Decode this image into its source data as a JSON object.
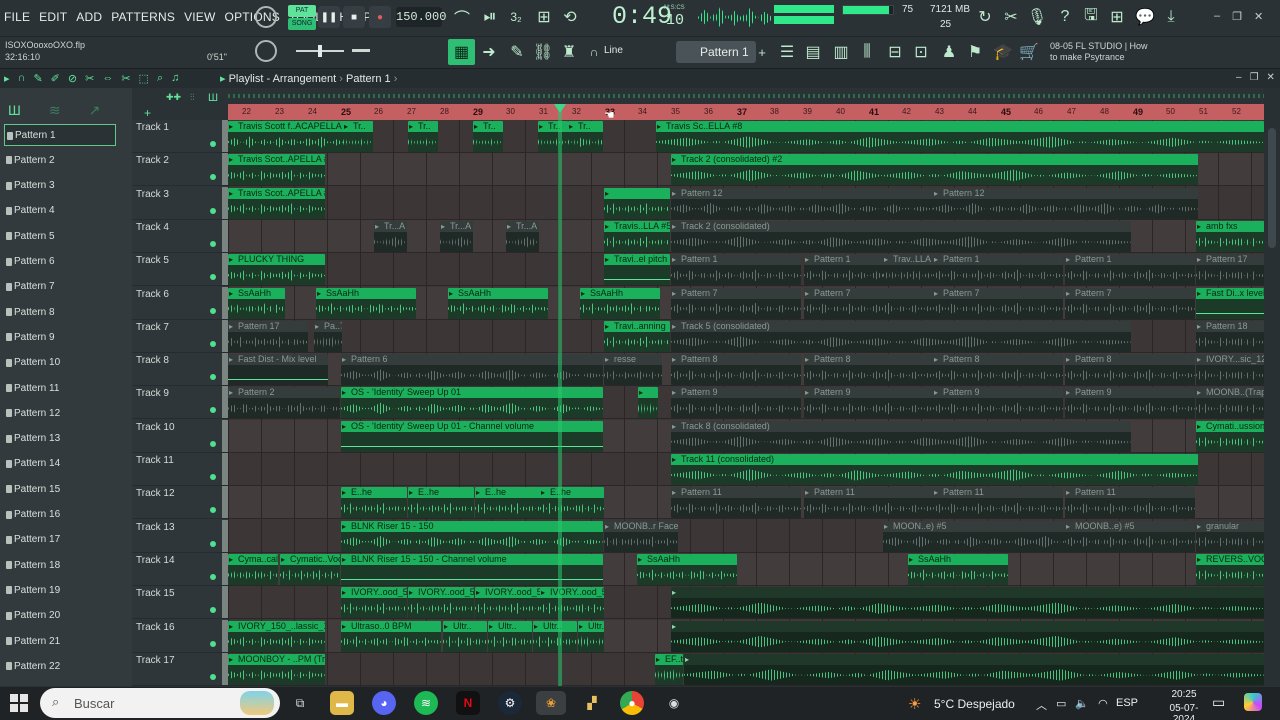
{
  "menu": [
    "FILE",
    "EDIT",
    "ADD",
    "PATTERNS",
    "VIEW",
    "OPTIONS",
    "TOOLS",
    "HELP"
  ],
  "transport": {
    "pat_label": "PAT",
    "song_label": "SONG",
    "tempo": "150.000",
    "time": "0:49",
    "time_sub": "10",
    "time_unit": "M:S:CS"
  },
  "stats": {
    "cpu": "75",
    "memory": "7121 MB",
    "voices": "25"
  },
  "project": {
    "file": "ISOXOooxoOXO.flp",
    "position": "32:16:10",
    "length": "0'51\""
  },
  "toolbar": {
    "snap": "Line",
    "pattern": "Pattern 1"
  },
  "news": {
    "date": "08-05",
    "text1": "FL STUDIO | How",
    "text2": "to make Psytrance"
  },
  "playlist": {
    "title": "Playlist - Arrangement",
    "crumb": "Pattern 1"
  },
  "patterns": [
    "Pattern 1",
    "Pattern 2",
    "Pattern 3",
    "Pattern 4",
    "Pattern 5",
    "Pattern 6",
    "Pattern 7",
    "Pattern 8",
    "Pattern 9",
    "Pattern 10",
    "Pattern 11",
    "Pattern 12",
    "Pattern 13",
    "Pattern 14",
    "Pattern 15",
    "Pattern 16",
    "Pattern 17",
    "Pattern 18",
    "Pattern 19",
    "Pattern 20",
    "Pattern 21",
    "Pattern 22"
  ],
  "tracks": [
    "Track 1",
    "Track 2",
    "Track 3",
    "Track 4",
    "Track 5",
    "Track 6",
    "Track 7",
    "Track 8",
    "Track 9",
    "Track 10",
    "Track 11",
    "Track 12",
    "Track 13",
    "Track 14",
    "Track 15",
    "Track 16",
    "Track 17"
  ],
  "ruler": [
    "22",
    "23",
    "24",
    "25",
    "26",
    "27",
    "28",
    "29",
    "30",
    "31",
    "32",
    "33",
    "34",
    "35",
    "36",
    "37",
    "38",
    "39",
    "40",
    "41",
    "42",
    "43",
    "44",
    "45",
    "46",
    "47",
    "48",
    "49",
    "50",
    "51",
    "52"
  ],
  "clips": [
    {
      "t": 0,
      "c": "g",
      "l": "Travis Scott f..ACAPELLA #8"
    },
    {
      "t": 0,
      "c": "g",
      "l": "Tr.."
    },
    {
      "t": 0,
      "c": "g",
      "l": "Tr.."
    },
    {
      "t": 0,
      "c": "g",
      "l": "Tr.."
    },
    {
      "t": 0,
      "c": "g",
      "l": "Tr.."
    },
    {
      "t": 0,
      "c": "g",
      "l": "Tr.."
    },
    {
      "t": 0,
      "c": "g",
      "l": "Travis Sc..ELLA #8"
    },
    {
      "t": 1,
      "c": "g",
      "l": "Travis Scot..APELLA #4"
    },
    {
      "t": 1,
      "c": "g",
      "l": "Track 2 (consolidated) #2"
    },
    {
      "t": 2,
      "c": "g",
      "l": "Travis Scot..APELLA #7"
    },
    {
      "t": 2,
      "c": "g",
      "l": ""
    },
    {
      "t": 2,
      "c": "d",
      "l": "Pattern 12"
    },
    {
      "t": 2,
      "c": "d",
      "l": "Pattern 12"
    },
    {
      "t": 3,
      "c": "d",
      "l": "Tr...A"
    },
    {
      "t": 3,
      "c": "d",
      "l": "Tr...A"
    },
    {
      "t": 3,
      "c": "d",
      "l": "Tr...A"
    },
    {
      "t": 3,
      "c": "g",
      "l": "Travis..LLA #5"
    },
    {
      "t": 3,
      "c": "d",
      "l": "Track 2 (consolidated)"
    },
    {
      "t": 3,
      "c": "g",
      "l": "amb fxs"
    },
    {
      "t": 4,
      "c": "g",
      "l": "PLUCKY THING"
    },
    {
      "t": 4,
      "c": "g",
      "l": "Travi..el pitch"
    },
    {
      "t": 4,
      "c": "d",
      "l": "Pattern 1"
    },
    {
      "t": 4,
      "c": "d",
      "l": "Pattern 1"
    },
    {
      "t": 4,
      "c": "d",
      "l": "Trav..LLA"
    },
    {
      "t": 4,
      "c": "d",
      "l": "Pattern 1"
    },
    {
      "t": 4,
      "c": "d",
      "l": "Pattern 1"
    },
    {
      "t": 4,
      "c": "d",
      "l": "Pattern 17"
    },
    {
      "t": 5,
      "c": "g",
      "l": "SsAaHh"
    },
    {
      "t": 5,
      "c": "g",
      "l": "SsAaHh"
    },
    {
      "t": 5,
      "c": "g",
      "l": "SsAaHh"
    },
    {
      "t": 5,
      "c": "g",
      "l": "SsAaHh"
    },
    {
      "t": 5,
      "c": "d",
      "l": "Pattern 7"
    },
    {
      "t": 5,
      "c": "d",
      "l": "Pattern 7"
    },
    {
      "t": 5,
      "c": "d",
      "l": "Pattern 7"
    },
    {
      "t": 5,
      "c": "d",
      "l": "Pattern 7"
    },
    {
      "t": 5,
      "c": "g",
      "l": "Fast Di..x level"
    },
    {
      "t": 6,
      "c": "d",
      "l": "Pattern 17"
    },
    {
      "t": 6,
      "c": "d",
      "l": "Pa..7"
    },
    {
      "t": 6,
      "c": "g",
      "l": "Travi..anning"
    },
    {
      "t": 6,
      "c": "d",
      "l": "Track 5 (consolidated)"
    },
    {
      "t": 6,
      "c": "d",
      "l": "Pattern 18"
    },
    {
      "t": 7,
      "c": "d",
      "l": "Fast Dist - Mix level"
    },
    {
      "t": 7,
      "c": "d",
      "l": "Pattern 6"
    },
    {
      "t": 7,
      "c": "d",
      "l": "resse"
    },
    {
      "t": 7,
      "c": "d",
      "l": "Pattern 8"
    },
    {
      "t": 7,
      "c": "d",
      "l": "Pattern 8"
    },
    {
      "t": 7,
      "c": "d",
      "l": "Pattern 8"
    },
    {
      "t": 7,
      "c": "d",
      "l": "Pattern 8"
    },
    {
      "t": 7,
      "c": "d",
      "l": "IVORY...sic_12"
    },
    {
      "t": 8,
      "c": "d",
      "l": "Pattern 2"
    },
    {
      "t": 8,
      "c": "g",
      "l": "OS - 'Identity' Sweep Up 01"
    },
    {
      "t": 8,
      "c": "g",
      "l": ""
    },
    {
      "t": 8,
      "c": "d",
      "l": "Pattern 9"
    },
    {
      "t": 8,
      "c": "d",
      "l": "Pattern 9"
    },
    {
      "t": 8,
      "c": "d",
      "l": "Pattern 9"
    },
    {
      "t": 8,
      "c": "d",
      "l": "Pattern 9"
    },
    {
      "t": 8,
      "c": "d",
      "l": "MOONB..(Trap)"
    },
    {
      "t": 9,
      "c": "g",
      "l": "OS - 'Identity' Sweep Up 01 - Channel volume"
    },
    {
      "t": 9,
      "c": "d",
      "l": "Track 8 (consolidated)"
    },
    {
      "t": 9,
      "c": "g",
      "l": "Cymati..ussion"
    },
    {
      "t": 10,
      "c": "g",
      "l": "Track 11 (consolidated)"
    },
    {
      "t": 11,
      "c": "g",
      "l": "E..he"
    },
    {
      "t": 11,
      "c": "g",
      "l": "E..he"
    },
    {
      "t": 11,
      "c": "g",
      "l": "E..he"
    },
    {
      "t": 11,
      "c": "g",
      "l": "E..he"
    },
    {
      "t": 11,
      "c": "d",
      "l": "Pattern 11"
    },
    {
      "t": 11,
      "c": "d",
      "l": "Pattern 11"
    },
    {
      "t": 11,
      "c": "d",
      "l": "Pattern 11"
    },
    {
      "t": 11,
      "c": "d",
      "l": "Pattern 11"
    },
    {
      "t": 12,
      "c": "g",
      "l": "BLNK Riser 15 - 150"
    },
    {
      "t": 12,
      "c": "d",
      "l": "MOONB..r Face"
    },
    {
      "t": 12,
      "c": "d",
      "l": "MOON..e) #5"
    },
    {
      "t": 12,
      "c": "d",
      "l": "MOONB..e) #5"
    },
    {
      "t": 12,
      "c": "d",
      "l": "granular"
    },
    {
      "t": 13,
      "c": "g",
      "l": "Cyma..cal"
    },
    {
      "t": 13,
      "c": "g",
      "l": "Cymatic..Vocal"
    },
    {
      "t": 13,
      "c": "g",
      "l": "BLNK Riser 15 - 150 - Channel volume"
    },
    {
      "t": 13,
      "c": "g",
      "l": "SsAaHh"
    },
    {
      "t": 13,
      "c": "g",
      "l": "SsAaHh"
    },
    {
      "t": 13,
      "c": "g",
      "l": "REVERS..VOCAL"
    },
    {
      "t": 14,
      "c": "g",
      "l": "IVORY..ood_5"
    },
    {
      "t": 14,
      "c": "g",
      "l": "IVORY..ood_5"
    },
    {
      "t": 14,
      "c": "g",
      "l": "IVORY..ood_5"
    },
    {
      "t": 14,
      "c": "g",
      "l": "IVORY..ood_5"
    },
    {
      "t": 14,
      "c": "m",
      "l": ""
    },
    {
      "t": 15,
      "c": "g",
      "l": "IVORY_150_..lassic_12"
    },
    {
      "t": 15,
      "c": "g",
      "l": "Ultraso..0 BPM"
    },
    {
      "t": 15,
      "c": "g",
      "l": "Ultr.."
    },
    {
      "t": 15,
      "c": "g",
      "l": "Ultr.."
    },
    {
      "t": 15,
      "c": "g",
      "l": "Ultr.."
    },
    {
      "t": 15,
      "c": "g",
      "l": "Ultr.."
    },
    {
      "t": 15,
      "c": "m",
      "l": ""
    },
    {
      "t": 16,
      "c": "g",
      "l": "MOONBOY - ..PM (Trap)"
    },
    {
      "t": 16,
      "c": "g",
      "l": "EF..tf"
    },
    {
      "t": 16,
      "c": "m",
      "l": ""
    }
  ],
  "taskbar": {
    "search": "Buscar",
    "weather": "5°C  Despejado",
    "lang": "ESP",
    "time": "20:25",
    "date": "05-07-2024"
  },
  "colors": {
    "accent": "#1bb05c",
    "ruler": "#c45f62",
    "background": "#3c3637"
  }
}
